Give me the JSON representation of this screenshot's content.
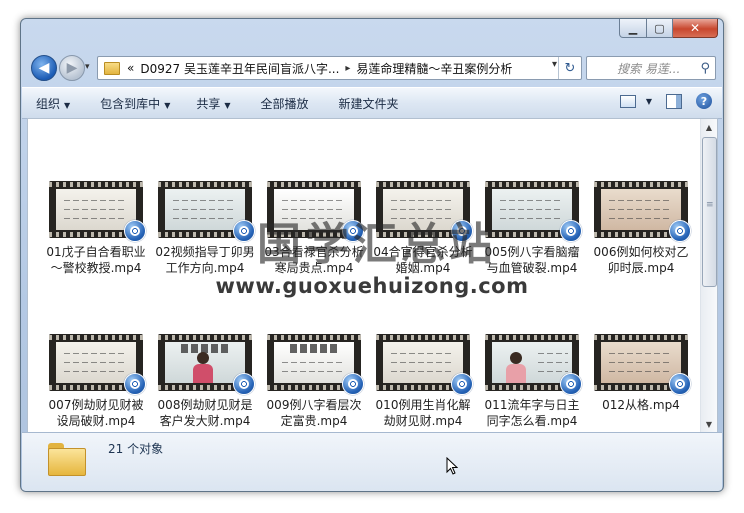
{
  "window": {
    "caption": {
      "minimize_glyph": "▁",
      "maximize_glyph": "▢",
      "close_glyph": "✕"
    }
  },
  "nav": {
    "back_glyph": "◀",
    "forward_glyph": "▶",
    "recent_glyph": "▾"
  },
  "address": {
    "chevron": "«",
    "segments": [
      "D0927 吴玉莲辛丑年民间盲派八字...",
      "易莲命理精髓～辛丑案例分析"
    ],
    "separator": "▸",
    "dropdown_glyph": "▾",
    "refresh_glyph": "↻"
  },
  "search": {
    "placeholder": "搜索 易莲...",
    "icon": "search-icon"
  },
  "toolbar": {
    "organize": "组织",
    "include_in_library": "包含到库中",
    "share": "共享",
    "play_all": "全部播放",
    "new_folder": "新建文件夹",
    "dropdown_glyph": "▼",
    "help_glyph": "?"
  },
  "files": [
    {
      "name": "01戊子自合看职业～警校教授.mp4",
      "frame": "board"
    },
    {
      "name": "02视频指导丁卯男工作方向.mp4",
      "frame": "board"
    },
    {
      "name": "03合看禄官杀分析寒局贵点.mp4",
      "frame": "board"
    },
    {
      "name": "04合官得官杀分析婚姻.mp4",
      "frame": "board"
    },
    {
      "name": "005例八字看脑瘤与血管破裂.mp4",
      "frame": "board"
    },
    {
      "name": "006例如何校对乙卯时辰.mp4",
      "frame": "board"
    },
    {
      "name": "007例劫财见财被设局破财.mp4",
      "frame": "board"
    },
    {
      "name": "008例劫财见财是客户发大财.mp4",
      "frame": "banner-person"
    },
    {
      "name": "009例八字看层次定富贵.mp4",
      "frame": "banner"
    },
    {
      "name": "010例用生肖化解劫财见财.mp4",
      "frame": "board"
    },
    {
      "name": "011流年字与日主同字怎么看.mp4",
      "frame": "person"
    },
    {
      "name": "012从格.mp4",
      "frame": "board"
    }
  ],
  "watermark": {
    "cn": "国学汇总站",
    "url": "www.guoxuehuizong.com"
  },
  "details": {
    "count": "21 个对象"
  },
  "scroll": {
    "up_glyph": "▲",
    "down_glyph": "▼"
  }
}
